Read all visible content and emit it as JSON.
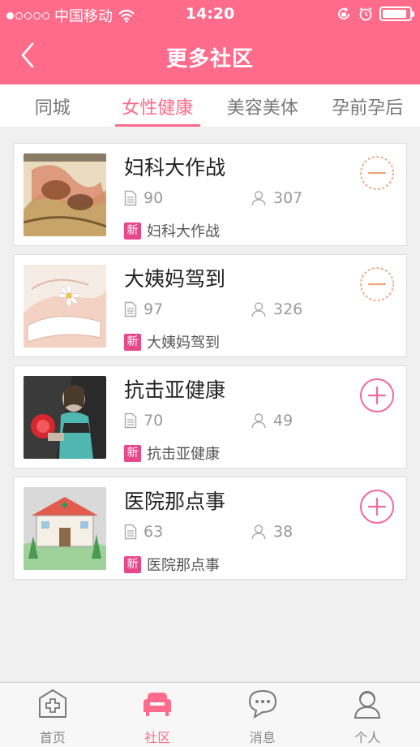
{
  "status_bar": {
    "carrier": "中国移动",
    "time": "14:20",
    "signal_icon": "signal-dots-icon",
    "wifi_icon": "wifi-icon",
    "battery_level": 0.9
  },
  "nav": {
    "title": "更多社区",
    "back_icon": "chevron-left-icon"
  },
  "tabs": [
    {
      "label": "同城",
      "active": false
    },
    {
      "label": "女性健康",
      "active": true
    },
    {
      "label": "美容美体",
      "active": false
    },
    {
      "label": "孕前孕后",
      "active": false
    }
  ],
  "communities": [
    {
      "name": "妇科大作战",
      "posts": "90",
      "members": "307",
      "badge": "新",
      "latest": "妇科大作战",
      "joined": true,
      "thumb": "illustration-couple"
    },
    {
      "name": "大姨妈驾到",
      "posts": "97",
      "members": "326",
      "badge": "新",
      "latest": "大姨妈驾到",
      "joined": true,
      "thumb": "illustration-hands-flower"
    },
    {
      "name": "抗击亚健康",
      "posts": "70",
      "members": "49",
      "badge": "新",
      "latest": "抗击亚健康",
      "joined": false,
      "thumb": "illustration-boxer"
    },
    {
      "name": "医院那点事",
      "posts": "63",
      "members": "38",
      "badge": "新",
      "latest": "医院那点事",
      "joined": false,
      "thumb": "illustration-hospital"
    }
  ],
  "tabbar": [
    {
      "label": "首页",
      "icon": "home-cross-icon",
      "active": false
    },
    {
      "label": "社区",
      "icon": "sofa-icon",
      "active": true
    },
    {
      "label": "消息",
      "icon": "chat-bubble-icon",
      "active": false
    },
    {
      "label": "个人",
      "icon": "person-icon",
      "active": false
    }
  ],
  "colors": {
    "brand": "#ff6b8a",
    "badge": "#e8478b",
    "leave_orange": "#f0a37a",
    "join_pink": "#ef6aa0"
  }
}
